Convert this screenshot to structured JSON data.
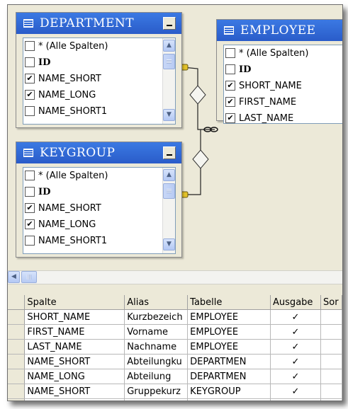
{
  "tables": {
    "department": {
      "title": "DEPARTMENT",
      "columns": [
        {
          "label": "* (Alle Spalten)",
          "checked": false,
          "bold": false
        },
        {
          "label": "ID",
          "checked": false,
          "bold": true
        },
        {
          "label": "NAME_SHORT",
          "checked": true,
          "bold": false
        },
        {
          "label": "NAME_LONG",
          "checked": true,
          "bold": false
        },
        {
          "label": "NAME_SHORT1",
          "checked": false,
          "bold": false
        }
      ]
    },
    "employee": {
      "title": "EMPLOYEE",
      "columns": [
        {
          "label": "* (Alle Spalten)",
          "checked": false,
          "bold": false
        },
        {
          "label": "ID",
          "checked": false,
          "bold": true
        },
        {
          "label": "SHORT_NAME",
          "checked": true,
          "bold": false
        },
        {
          "label": "FIRST_NAME",
          "checked": true,
          "bold": false
        },
        {
          "label": "LAST_NAME",
          "checked": true,
          "bold": false
        }
      ]
    },
    "keygroup": {
      "title": "KEYGROUP",
      "columns": [
        {
          "label": "* (Alle Spalten)",
          "checked": false,
          "bold": false
        },
        {
          "label": "ID",
          "checked": false,
          "bold": true
        },
        {
          "label": "NAME_SHORT",
          "checked": true,
          "bold": false
        },
        {
          "label": "NAME_LONG",
          "checked": true,
          "bold": false
        },
        {
          "label": "NAME_SHORT1",
          "checked": false,
          "bold": false
        }
      ]
    }
  },
  "grid": {
    "headers": [
      "Spalte",
      "Alias",
      "Tabelle",
      "Ausgabe",
      "Sor"
    ],
    "rows": [
      [
        "SHORT_NAME",
        "Kurzbezeich",
        "EMPLOYEE",
        "✓",
        ""
      ],
      [
        "FIRST_NAME",
        "Vorname",
        "EMPLOYEE",
        "✓",
        ""
      ],
      [
        "LAST_NAME",
        "Nachname",
        "EMPLOYEE",
        "✓",
        ""
      ],
      [
        "NAME_SHORT",
        "Abteilungku",
        "DEPARTMEN",
        "✓",
        ""
      ],
      [
        "NAME_LONG",
        "Abteilung",
        "DEPARTMEN",
        "✓",
        ""
      ],
      [
        "NAME_SHORT",
        "Gruppekurz",
        "KEYGROUP",
        "✓",
        ""
      ]
    ]
  },
  "colors": {
    "title_bar": "#2f66d6",
    "surface": "#ece9d8",
    "scroll_button": "#c4d5f7"
  }
}
